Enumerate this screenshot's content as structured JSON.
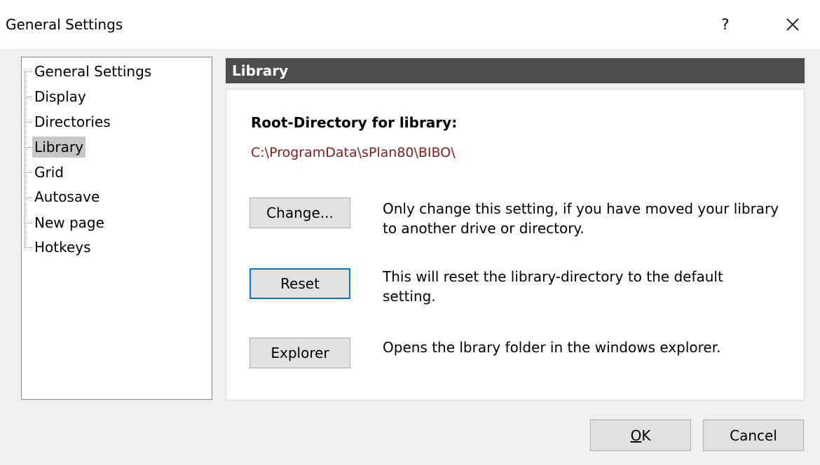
{
  "window": {
    "title": "General Settings",
    "help_label": "?",
    "close_icon": "close-icon"
  },
  "tree": {
    "items": [
      {
        "label": "General Settings",
        "selected": false
      },
      {
        "label": "Display",
        "selected": false
      },
      {
        "label": "Directories",
        "selected": false
      },
      {
        "label": "Library",
        "selected": true
      },
      {
        "label": "Grid",
        "selected": false
      },
      {
        "label": "Autosave",
        "selected": false
      },
      {
        "label": "New page",
        "selected": false
      },
      {
        "label": "Hotkeys",
        "selected": false
      }
    ]
  },
  "panel": {
    "header": "Library",
    "root_label": "Root-Directory for library:",
    "root_path": "C:\\ProgramData\\sPlan80\\BIBO\\",
    "rows": [
      {
        "button": "Change...",
        "desc_line1": "Only change this setting, if you have moved your library",
        "desc_line2": "to another drive or directory."
      },
      {
        "button": "Reset",
        "desc_line1": "This will reset the library-directory to the default",
        "desc_line2": "setting."
      },
      {
        "button": "Explorer",
        "desc_line1": "Opens the lbrary folder in the windows explorer.",
        "desc_line2": ""
      }
    ]
  },
  "footer": {
    "ok_mnemonic": "O",
    "ok_rest": "K",
    "cancel_label": "Cancel"
  },
  "colors": {
    "header_bg": "#4d4d4d",
    "path_color": "#8b1a1a",
    "focus_border": "#0078d7"
  }
}
